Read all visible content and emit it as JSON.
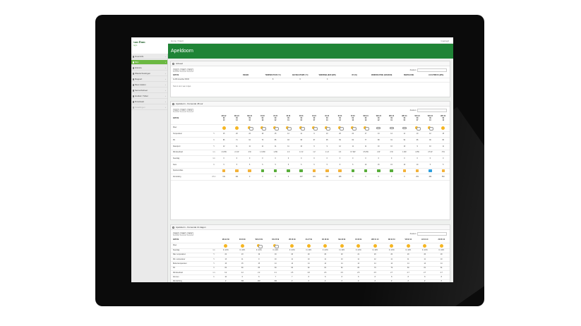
{
  "app": {
    "logo": "van Dam",
    "logo_sub": "Agro",
    "breadcrumb": "Home  /  Kaart",
    "user": "Ingelogd",
    "page_title": "Apeldoorn"
  },
  "sidebar": {
    "items": [
      {
        "label": "Overzicht",
        "active": false
      },
      {
        "label": "Mijn",
        "active": true
      },
      {
        "label": "Historie",
        "active": false
      },
      {
        "label": "Waarschuwingen",
        "active": false
      },
      {
        "label": "Rapport",
        "active": false
      },
      {
        "label": "Meet station",
        "active": false
      },
      {
        "label": "Sensorbeheer",
        "active": false
      },
      {
        "label": "Grafiek / Tabel",
        "active": false
      },
      {
        "label": "Download",
        "active": false
      },
      {
        "label": "Instellingen",
        "active": false
      }
    ]
  },
  "panel_current": {
    "title": "Actueel",
    "tools": [
      "Copy",
      "CSV",
      "Print"
    ],
    "search_label": "Zoeken:",
    "columns": [
      "DATUM",
      "REGEN",
      "TEMPERATUUR (°C)",
      "GEVOELSTEMP. (°C)",
      "WINDSNELHEID (M/S)",
      "RV (%)",
      "WINDRICHTING (GRADEN)",
      "BEWOLKING",
      "LUCHTDRUK (HPA)"
    ],
    "row": [
      "za 08 november 06:00",
      "",
      "8",
      "6",
      "3",
      "",
      "",
      "",
      ""
    ],
    "footer": "Toon 1 tot 1 van 1 rijen"
  },
  "panel_48h": {
    "title": "Apeldoorn - Komende 48 uur",
    "tools": [
      "Copy",
      "CSV",
      "Print"
    ],
    "search_label": "Zoeken:",
    "label_header": "DATUM",
    "times": [
      [
        "MA 22",
        "09",
        "10"
      ],
      [
        "MA 22",
        "09",
        "13"
      ],
      [
        "MA 22",
        "09",
        "16"
      ],
      [
        "DI 23",
        "09",
        "19"
      ],
      [
        "DI 23",
        "09",
        "22"
      ],
      [
        "DI 23",
        "09",
        "01"
      ],
      [
        "DI 23",
        "09",
        "04"
      ],
      [
        "DI 23",
        "09",
        "07"
      ],
      [
        "DI 23",
        "09",
        "10"
      ],
      [
        "DI 23",
        "09",
        "13"
      ],
      [
        "DI 23",
        "09",
        "16"
      ],
      [
        "WO 24",
        "09",
        "19"
      ],
      [
        "WO 24",
        "09",
        "22"
      ],
      [
        "WO 24",
        "09",
        "01"
      ],
      [
        "WO 24",
        "09",
        "04"
      ],
      [
        "WO 24",
        "09",
        "07"
      ],
      [
        "WO 24",
        "09",
        "10"
      ],
      [
        "WO 24",
        "09",
        "13"
      ]
    ],
    "weather_label": "Weer",
    "weather": [
      "sun",
      "sun",
      "psun",
      "psun",
      "psun",
      "psun",
      "psun",
      "psun",
      "psun",
      "psun",
      "psun",
      "psun",
      "cloud",
      "cloud",
      "cloud",
      "psun",
      "psun",
      "sun"
    ],
    "rows": [
      {
        "label": "Temperatuur",
        "unit": "°C",
        "values": [
          "15",
          "20",
          "22",
          "19",
          "15",
          "12",
          "11",
          "9",
          "10",
          "20",
          "22",
          "17",
          "13",
          "12",
          "11",
          "10",
          "12",
          "15"
        ]
      },
      {
        "label": "RV",
        "unit": "%",
        "values": [
          "96",
          "71",
          "64",
          "73",
          "85",
          "93",
          "95",
          "97",
          "95",
          "69",
          "62",
          "77",
          "88",
          "91",
          "94",
          "96",
          "90",
          "80"
        ]
      },
      {
        "label": "Dauwpunt",
        "unit": "°C",
        "values": [
          "12",
          "11",
          "11",
          "11",
          "11",
          "11",
          "10",
          "9",
          "9",
          "12",
          "11",
          "11",
          "10",
          "10",
          "10",
          "9",
          "10",
          "11"
        ]
      },
      {
        "label": "Windsnelheid",
        "unit": "m/s",
        "values": [
          "1.6 ZW",
          "2.4 W",
          "2 W",
          "1.3 ZW",
          "1 ZW",
          "1 Z",
          "1.3 Z",
          "1 Z",
          "1.1 Z",
          "2 Z",
          "3.7 ZW",
          "3.5 ZW",
          "2 W",
          "2 W",
          "1 ZW",
          "2 ZW",
          "2.5 W",
          "3 W"
        ]
      },
      {
        "label": "Neerslag",
        "unit": "mm",
        "values": [
          "0",
          "0",
          "0",
          "0",
          "0",
          "0",
          "0",
          "0",
          "0",
          "0",
          "0",
          "0",
          "0",
          "0",
          "0",
          "0",
          "0",
          "0"
        ]
      },
      {
        "label": "Kans",
        "unit": "%",
        "values": [
          "5",
          "5",
          "5",
          "5",
          "5",
          "5",
          "5",
          "5",
          "5",
          "5",
          "5",
          "10",
          "15",
          "15",
          "10",
          "10",
          "5",
          "5"
        ]
      },
      {
        "label": "Spuitcondities",
        "unit": "",
        "values": [
          "orange",
          "orange",
          "orange",
          "green",
          "green",
          "green",
          "green",
          "orange",
          "orange",
          "orange",
          "green",
          "green",
          "green",
          "green",
          "orange",
          "orange",
          "blue",
          "orange"
        ]
      },
      {
        "label": "Zonstraling",
        "unit": "W/m²",
        "values": [
          "311",
          "191",
          "0",
          "0",
          "0",
          "0",
          "207",
          "421",
          "310",
          "106",
          "0",
          "0",
          "0",
          "0",
          "0",
          "251",
          "404",
          "352"
        ]
      }
    ]
  },
  "panel_14d": {
    "title": "Apeldoorn - Komende 14 dagen",
    "tools": [
      "Copy",
      "CSV",
      "Print"
    ],
    "search_label": "Zoeken:",
    "label_header": "DATUM",
    "days": [
      "MA 22 09",
      "DI 23 09",
      "WO 24 09",
      "DO 25 09",
      "VR 26 09",
      "ZA 27 09",
      "ZO 28 09",
      "MA 29 09",
      "DI 30 09",
      "WO 01 10",
      "DO 02 10",
      "VR 03 10",
      "ZA 04 10",
      "ZO 05 10"
    ],
    "weather_label": "Weer",
    "weather": [
      "sun",
      "sun",
      "psun",
      "psun",
      "sun",
      "sun",
      "sun",
      "sun",
      "sun",
      "sun",
      "sun",
      "sun",
      "sun",
      "sun"
    ],
    "rows": [
      {
        "label": "Neerslag",
        "unit": "mm",
        "values": [
          "0 | 10%",
          "0 | 10%",
          "0 | 10%",
          "0 | 10%",
          "0 | 10%",
          "0 | 10%",
          "0 | 10%",
          "0 | 10%",
          "0 | 10%",
          "0 | 10%",
          "0 | 10%",
          "0 | 10%",
          "0 | 10%",
          "0 | 10%"
        ]
      },
      {
        "label": "Max. temperatuur",
        "unit": "°C",
        "values": [
          "22",
          "23",
          "19",
          "19",
          "20",
          "20",
          "20",
          "20",
          "21",
          "20",
          "20",
          "20",
          "20",
          "20"
        ]
      },
      {
        "label": "Min. temperatuur",
        "unit": "°C",
        "values": [
          "13",
          "11",
          "9",
          "10",
          "11",
          "10",
          "11",
          "10",
          "11",
          "12",
          "11",
          "11",
          "11",
          "10"
        ]
      },
      {
        "label": "Bodemtemperatuur",
        "unit": "°C",
        "values": [
          "16",
          "15",
          "15",
          "14",
          "14",
          "14",
          "14",
          "14",
          "14",
          "14",
          "14",
          "14",
          "14",
          "14"
        ]
      },
      {
        "label": "RV",
        "unit": "%",
        "values": [
          "82",
          "80",
          "85",
          "83",
          "82",
          "82",
          "81",
          "82",
          "80",
          "79",
          "79",
          "80",
          "81",
          "81"
        ]
      },
      {
        "label": "Windsnelheid",
        "unit": "m/s",
        "values": [
          "3.2",
          "4.2",
          "2.2",
          "2.1",
          "2.5",
          "2.8",
          "2.6",
          "2.5",
          "2.5",
          "2.5",
          "2.7",
          "2.7",
          "2.7",
          "2.7"
        ]
      },
      {
        "label": "Zonuren",
        "unit": "hr",
        "values": [
          "10",
          "6",
          "8",
          "7",
          "7",
          "8",
          "8",
          "8",
          "8",
          "8",
          "8",
          "8",
          "8",
          "8"
        ]
      },
      {
        "label": "Windrichting",
        "unit": "-",
        "values": [
          "Z",
          "ZW",
          "ZW",
          "ZW",
          "Z",
          "Z",
          "Z",
          "Z",
          "Z",
          "Z",
          "Z",
          "Z",
          "Z",
          "Z"
        ]
      },
      {
        "label": "Zonstraling",
        "unit": "W/m²",
        "values": [
          "2806",
          "2533",
          "2340",
          "2278",
          "2420",
          "2343",
          "2258",
          "2227",
          "2182",
          "2139",
          "2095",
          "2073",
          "2040",
          "1995"
        ]
      }
    ]
  }
}
